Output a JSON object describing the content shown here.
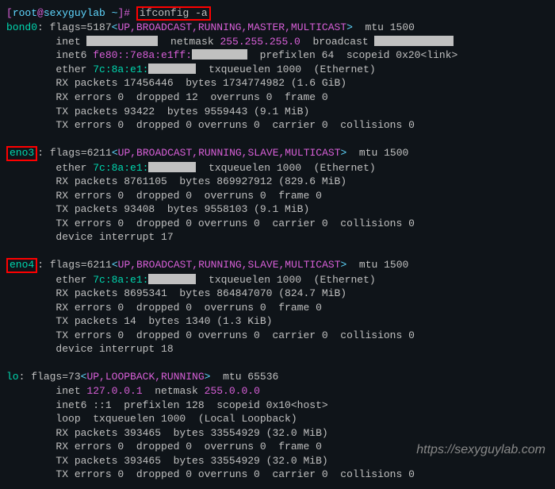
{
  "prompt": {
    "open": "[",
    "user": "root",
    "at": "@",
    "host": "sexyguylab",
    "path": " ~",
    "close": "]",
    "hash": "# "
  },
  "command": "ifconfig -a",
  "bond0": {
    "name": "bond0",
    "flags_pre": ": flags=5187",
    "flags": "UP,BROADCAST,RUNNING,MASTER,MULTICAST",
    "flags_post": "  mtu 1500",
    "inet_lbl": "        inet ",
    "netmask_lbl": "  netmask ",
    "netmask": "255.255.255.0",
    "bcast_lbl": "  broadcast ",
    "inet6_lbl": "        inet6 ",
    "inet6": "fe80::7e8a:e1ff:",
    "inet6_sfx": "  prefixlen 64  scopeid 0x20<link>",
    "ether_lbl": "        ether ",
    "ether": "7c:8a:e1:",
    "ether_sfx": "  txqueuelen 1000  (Ethernet)",
    "rxp": "        RX packets 17456446  bytes 1734774982 (1.6 GiB)",
    "rxe": "        RX errors 0  dropped 12  overruns 0  frame 0",
    "txp": "        TX packets 93422  bytes 9559443 (9.1 MiB)",
    "txe": "        TX errors 0  dropped 0 overruns 0  carrier 0  collisions 0"
  },
  "eno3": {
    "name": "eno3",
    "flags_pre": ": flags=6211",
    "flags": "UP,BROADCAST,RUNNING,SLAVE,MULTICAST",
    "flags_post": "  mtu 1500",
    "ether_lbl": "        ether ",
    "ether": "7c:8a:e1:",
    "ether_sfx": "  txqueuelen 1000  (Ethernet)",
    "rxp": "        RX packets 8761105  bytes 869927912 (829.6 MiB)",
    "rxe": "        RX errors 0  dropped 0  overruns 0  frame 0",
    "txp": "        TX packets 93408  bytes 9558103 (9.1 MiB)",
    "txe": "        TX errors 0  dropped 0 overruns 0  carrier 0  collisions 0",
    "irq": "        device interrupt 17"
  },
  "eno4": {
    "name": "eno4",
    "flags_pre": ": flags=6211",
    "flags": "UP,BROADCAST,RUNNING,SLAVE,MULTICAST",
    "flags_post": "  mtu 1500",
    "ether_lbl": "        ether ",
    "ether": "7c:8a:e1:",
    "ether_sfx": "  txqueuelen 1000  (Ethernet)",
    "rxp": "        RX packets 8695341  bytes 864847070 (824.7 MiB)",
    "rxe": "        RX errors 0  dropped 0  overruns 0  frame 0",
    "txp": "        TX packets 14  bytes 1340 (1.3 KiB)",
    "txe": "        TX errors 0  dropped 0 overruns 0  carrier 0  collisions 0",
    "irq": "        device interrupt 18"
  },
  "lo": {
    "name": "lo",
    "flags_pre": ": flags=73",
    "flags": "UP,LOOPBACK,RUNNING",
    "flags_post": "  mtu 65536",
    "inet_lbl": "        inet ",
    "inet": "127.0.0.1",
    "netmask_lbl": "  netmask ",
    "netmask": "255.0.0.0",
    "inet6": "        inet6 ::1  prefixlen 128  scopeid 0x10<host>",
    "loop": "        loop  txqueuelen 1000  (Local Loopback)",
    "rxp": "        RX packets 393465  bytes 33554929 (32.0 MiB)",
    "rxe": "        RX errors 0  dropped 0  overruns 0  frame 0",
    "txp": "        TX packets 393465  bytes 33554929 (32.0 MiB)",
    "txe": "        TX errors 0  dropped 0 overruns 0  carrier 0  collisions 0"
  },
  "lt": "<",
  "gt": ">",
  "watermark": "https://sexyguylab.com"
}
